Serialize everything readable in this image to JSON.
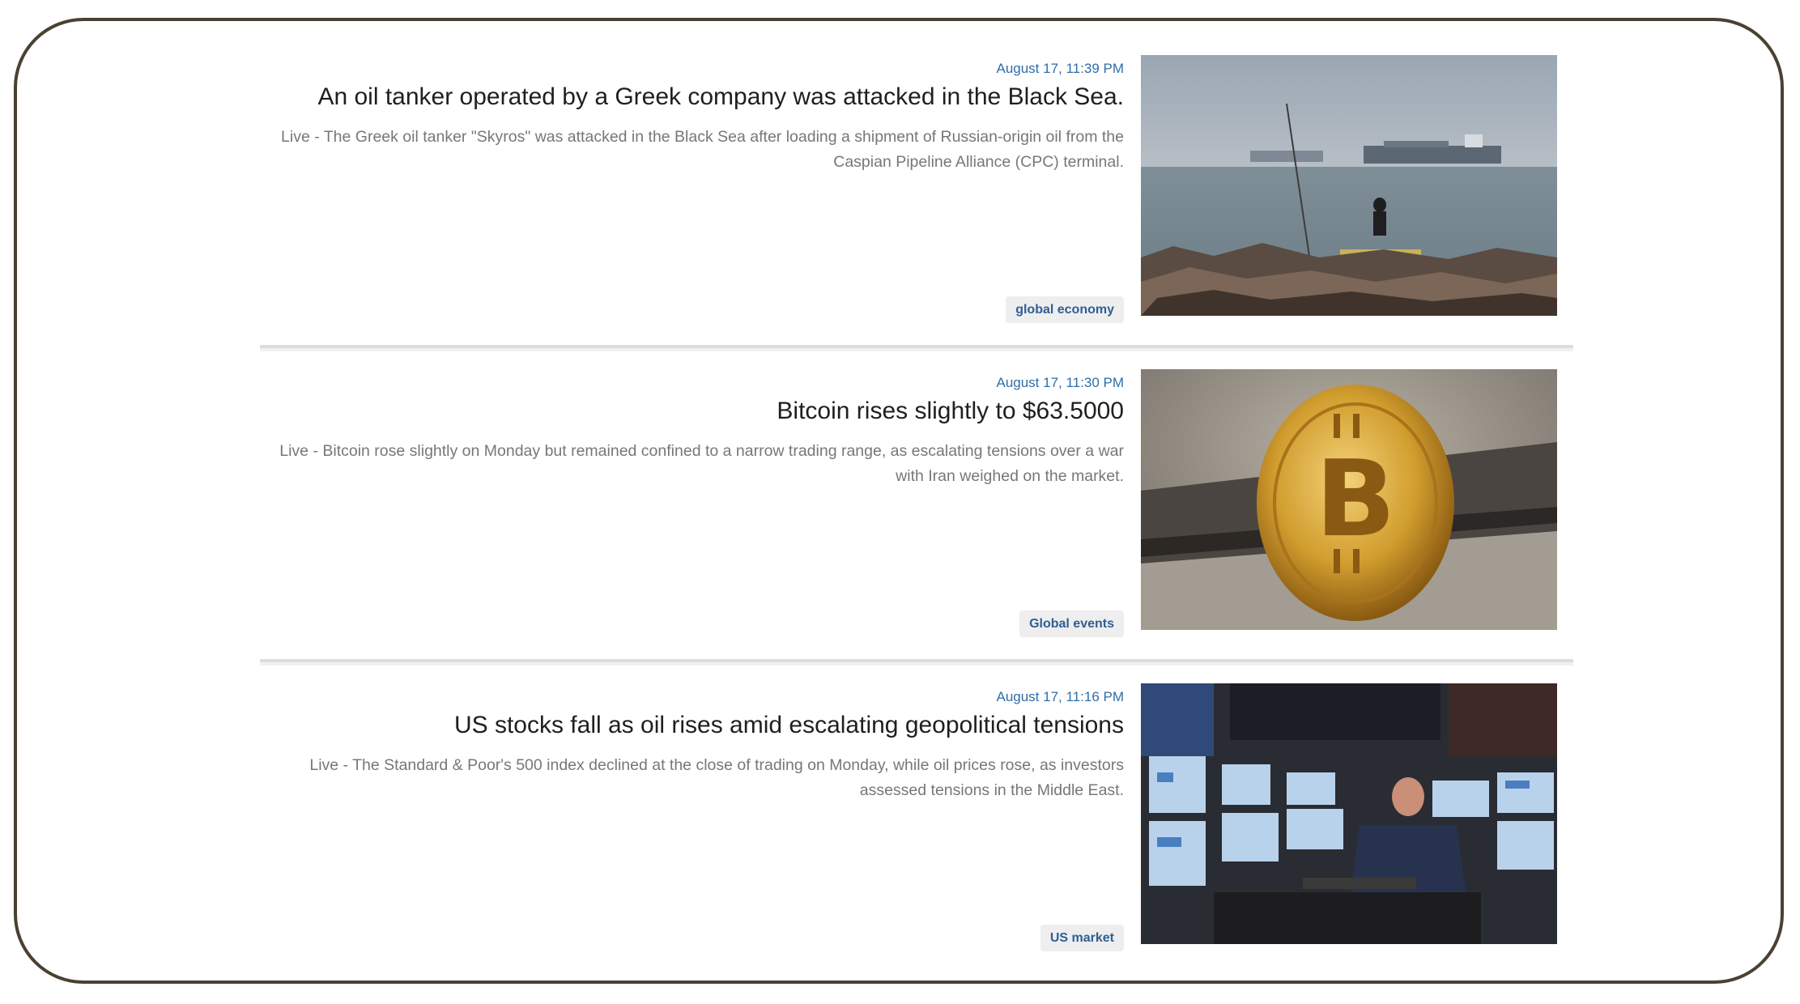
{
  "articles": [
    {
      "timestamp": "August 17, 11:39 PM",
      "headline": "An oil tanker operated by a Greek company was attacked in the Black Sea.",
      "summary": "Live - The Greek oil tanker \"Skyros\" was attacked in the Black Sea after loading a shipment of Russian-origin oil from the Caspian Pipeline Alliance (CPC) terminal.",
      "tag": "global economy",
      "image": "oil-tanker-at-sea-photo"
    },
    {
      "timestamp": "August 17, 11:30 PM",
      "headline": "Bitcoin rises slightly to $63.5000",
      "summary": "Live - Bitcoin rose slightly on Monday but remained confined to a narrow trading range, as escalating tensions over a war with Iran weighed on the market.",
      "tag": "Global events",
      "image": "bitcoin-coin-photo"
    },
    {
      "timestamp": "August 17, 11:16 PM",
      "headline": "US stocks fall as oil rises amid escalating geopolitical tensions",
      "summary": "Live - The Standard & Poor's 500 index declined at the close of trading on Monday, while oil prices rose, as investors assessed tensions in the Middle East.",
      "tag": "US market",
      "image": "stock-exchange-trader-photo"
    }
  ],
  "colors": {
    "timestamp": "#2f6ea8",
    "tag_text": "#2f5f93",
    "frame_border": "#4a4132"
  }
}
